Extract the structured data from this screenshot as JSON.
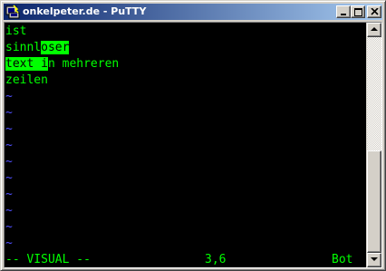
{
  "window": {
    "title": "onkelpeter.de - PuTTY",
    "app_icon": "putty-terminal-icon",
    "controls": {
      "minimize_icon": "minimize-icon",
      "maximize_icon": "maximize-icon",
      "close_icon": "close-icon"
    }
  },
  "terminal": {
    "colors": {
      "background": "#000000",
      "text": "#00ff00",
      "selection": "#00ff00",
      "tilde": "#5050ff"
    },
    "lines": {
      "line1": "ist",
      "line2_plain": "sinnl",
      "line2_selected": "oser",
      "line3_selected": "text ",
      "line3_cursor": "i",
      "line3_rest": "n mehreren",
      "line4": "zeilen"
    },
    "empty_line_marker": "~",
    "status": {
      "mode": "-- VISUAL --",
      "position": "3,6",
      "scroll": "Bot"
    }
  },
  "scrollbar": {
    "up_icon": "scroll-up-arrow-icon",
    "down_icon": "scroll-down-arrow-icon"
  }
}
